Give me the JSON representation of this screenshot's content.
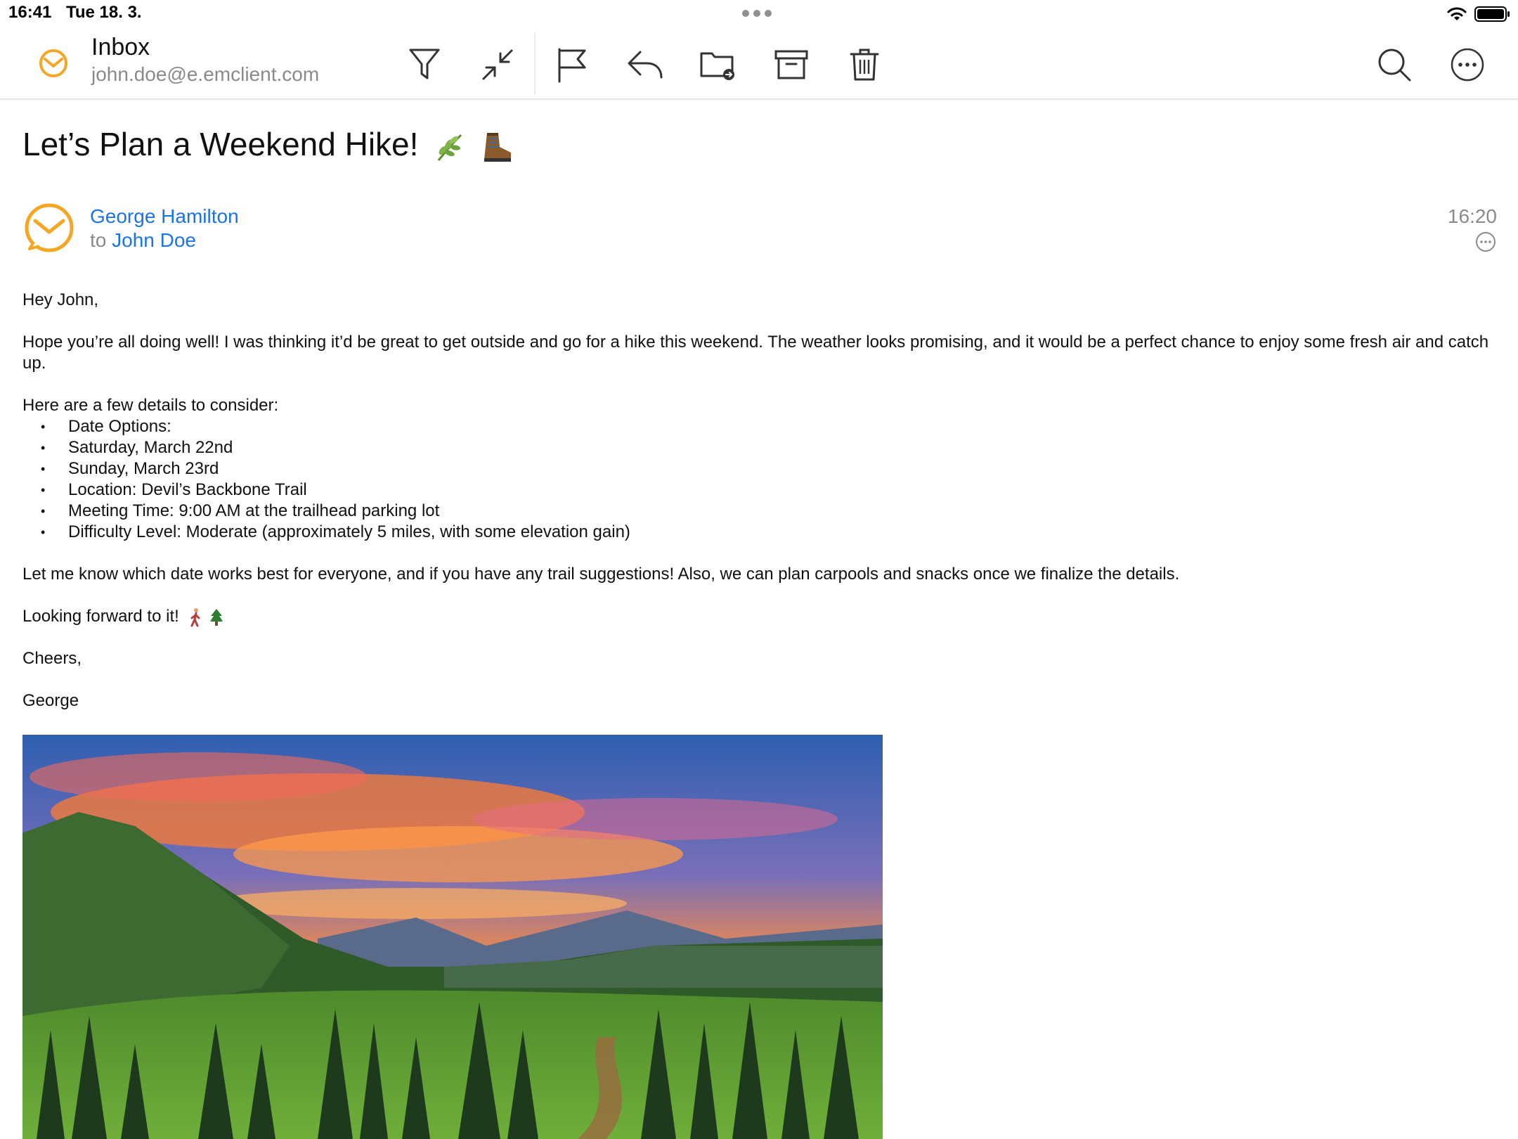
{
  "status_bar": {
    "time": "16:41",
    "date": "Tue 18. 3."
  },
  "toolbar": {
    "folder_title": "Inbox",
    "account": "john.doe@e.emclient.com",
    "icons": [
      "filter-icon",
      "collapse-icon",
      "flag-icon",
      "reply-icon",
      "move-to-folder-icon",
      "archive-icon",
      "trash-icon",
      "search-icon",
      "more-icon"
    ]
  },
  "message": {
    "subject": "Let’s Plan a Weekend Hike!",
    "sender_name": "George Hamilton",
    "recipient_prefix": "to",
    "recipient_name": "John Doe",
    "time": "16:20",
    "body": {
      "greeting": "Hey John,",
      "intro": "Hope you’re all doing well! I was thinking it’d be great to get outside and go for a hike this weekend. The weather looks promising, and it would be a perfect chance to enjoy some fresh air and catch up.",
      "details_heading": "Here are a few details to consider:",
      "details": [
        "Date Options:",
        "Saturday, March 22nd",
        "Sunday, March 23rd",
        "Location: Devil’s Backbone Trail",
        "Meeting Time: 9:00 AM at the trailhead parking lot",
        "Difficulty Level: Moderate (approximately 5 miles, with some elevation gain)"
      ],
      "request": "Let me know which date works best for everyone, and if you have any trail suggestions! Also, we can plan carpools and snacks once we finalize the details.",
      "looking_forward": "Looking forward to it!",
      "closing": "Cheers,",
      "signature": "George"
    }
  },
  "colors": {
    "accent_blue": "#1a73e8",
    "brand_orange": "#f5a623",
    "secondary_text": "#8a8a8e"
  }
}
